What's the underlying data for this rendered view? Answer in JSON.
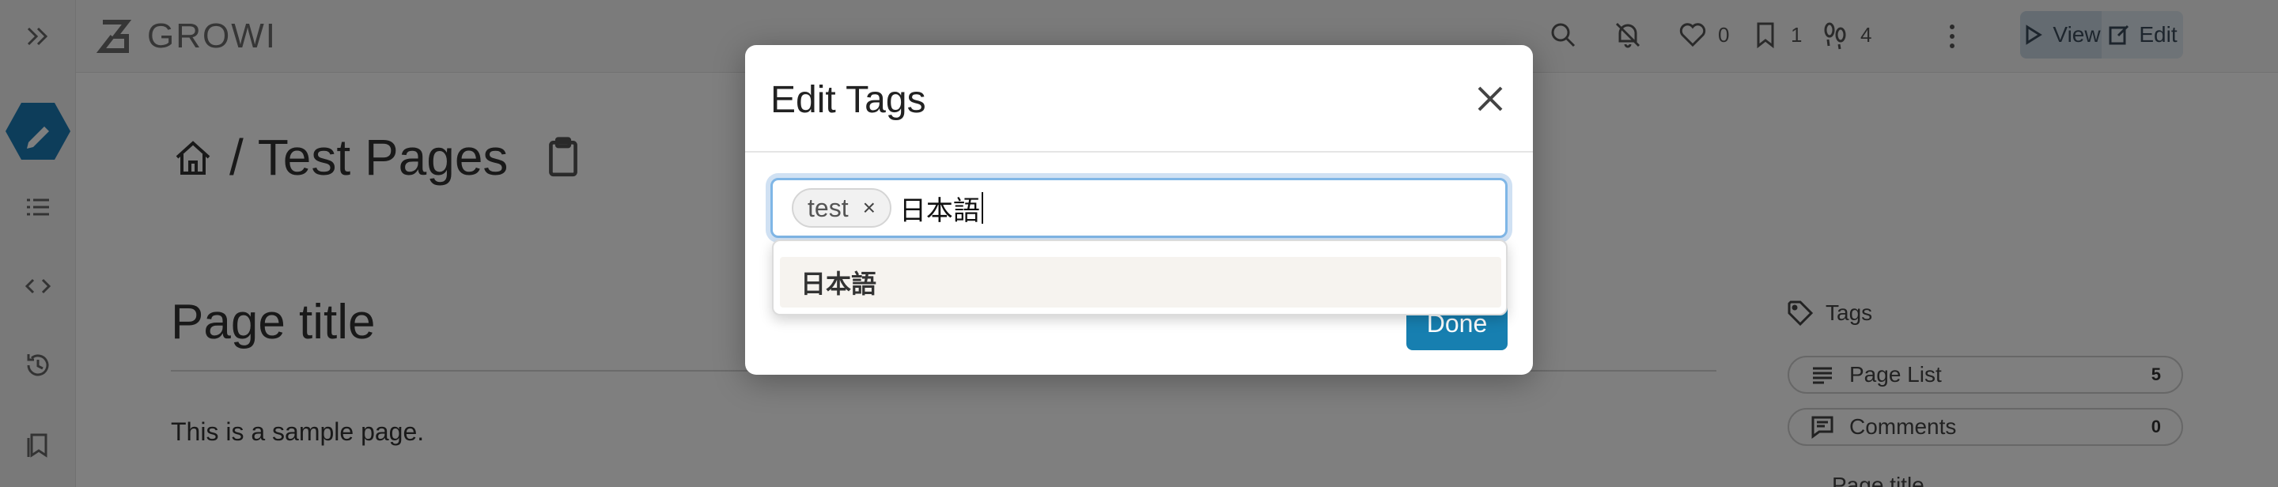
{
  "app": {
    "name": "GROWI"
  },
  "topbar": {
    "likes_count": "0",
    "bookmarks_count": "1",
    "seen_count": "4",
    "view_label": "View",
    "edit_label": "Edit"
  },
  "page": {
    "breadcrumb_sep": "/",
    "path": "Test Pages",
    "heading": "Page title",
    "paragraph": "This is a sample page."
  },
  "sidepanel": {
    "tags_label": "Tags",
    "pagelist_label": "Page List",
    "pagelist_count": "5",
    "comments_label": "Comments",
    "comments_count": "0",
    "toc_first": "Page title"
  },
  "modal": {
    "title": "Edit Tags",
    "tags": [
      {
        "label": "test",
        "remove": "×"
      }
    ],
    "input_value": "日本語",
    "suggestions": [
      "日本語"
    ],
    "done_label": "Done"
  },
  "colors": {
    "accent": "#177fb0",
    "sidebar_hex": "#1a7ab5"
  },
  "icons": {
    "sidebar": [
      "collapse-icon",
      "pencil-icon",
      "list-icon",
      "code-icon",
      "history-icon",
      "bookmarks-icon"
    ],
    "topbar": [
      "search-icon",
      "bell-off-icon",
      "heart-icon",
      "bookmark-icon",
      "footprints-icon",
      "more-icon",
      "play-icon",
      "edit-icon"
    ],
    "modal": [
      "close-icon"
    ],
    "page": [
      "home-icon",
      "copy-icon",
      "tag-icon",
      "list-icon",
      "comment-icon"
    ]
  }
}
